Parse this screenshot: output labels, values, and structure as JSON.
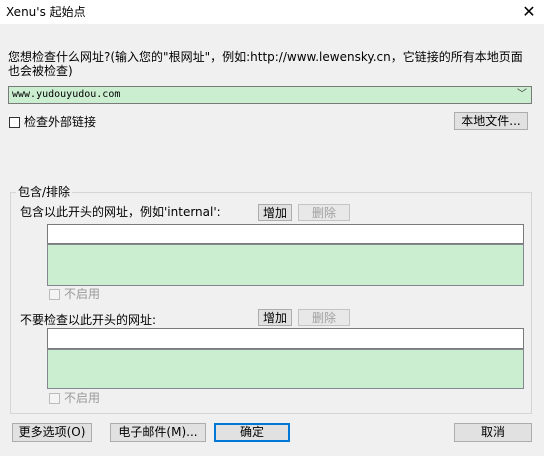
{
  "window": {
    "title": "Xenu's 起始点",
    "close_glyph": "✕"
  },
  "prompt": {
    "text": "您想检查什么网址?(输入您的\"根网址\"，例如:http://www.lewensky.cn，它链接的所有本地页面也会被检查)"
  },
  "url_combo": {
    "value": "www.yudouyudou.com",
    "arrow_glyph": "﹀"
  },
  "check_external": {
    "label": "检查外部链接",
    "checked": false
  },
  "buttons": {
    "local_file": "本地文件...",
    "add": "增加",
    "remove": "删除",
    "more_options": "更多选项(O)",
    "email": "电子邮件(M)...",
    "ok": "确定",
    "cancel": "取消"
  },
  "include_exclude": {
    "group_title": "包含/排除",
    "include_label": "包含以此开头的网址，例如'internal':",
    "include_input": "",
    "include_disable_label": "不启用",
    "exclude_label": "不要检查以此开头的网址:",
    "exclude_input": "",
    "exclude_disable_label": "不启用"
  },
  "colors": {
    "list_background": "#cceed0",
    "default_button_border": "#0078d7"
  }
}
